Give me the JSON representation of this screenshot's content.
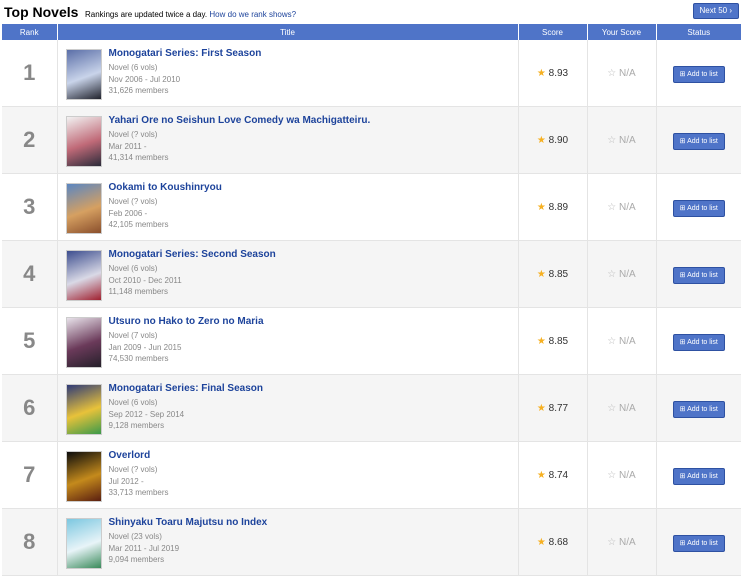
{
  "header": {
    "title": "Top Novels",
    "notice": "Rankings are updated twice a day.",
    "notice_link": "How do we rank shows?",
    "next_label": "Next 50 ›"
  },
  "columns": {
    "rank": "Rank",
    "title": "Title",
    "score": "Score",
    "your_score": "Your Score",
    "status": "Status"
  },
  "rows": [
    {
      "rank": "1",
      "title": "Monogatari Series: First Season",
      "type": "Novel (6 vols)",
      "dates": "Nov 2006 - Jul 2010",
      "members": "31,626 members",
      "score": "8.93",
      "your_score": "N/A",
      "button": "⊞ Add to list",
      "thumb_colors": [
        "#5b6fa8",
        "#c9d4ea",
        "#20222c"
      ]
    },
    {
      "rank": "2",
      "title": "Yahari Ore no Seishun Love Comedy wa Machigatteiru.",
      "type": "Novel (? vols)",
      "dates": "Mar 2011 -",
      "members": "41,314 members",
      "score": "8.90",
      "your_score": "N/A",
      "button": "⊞ Add to list",
      "thumb_colors": [
        "#f2f2f2",
        "#c06a78",
        "#2b2b3a"
      ]
    },
    {
      "rank": "3",
      "title": "Ookami to Koushinryou",
      "type": "Novel (? vols)",
      "dates": "Feb 2006 -",
      "members": "42,105 members",
      "score": "8.89",
      "your_score": "N/A",
      "button": "⊞ Add to list",
      "thumb_colors": [
        "#5a86c2",
        "#d6a061",
        "#8a4f2c"
      ]
    },
    {
      "rank": "4",
      "title": "Monogatari Series: Second Season",
      "type": "Novel (6 vols)",
      "dates": "Oct 2010 - Dec 2011",
      "members": "11,148 members",
      "score": "8.85",
      "your_score": "N/A",
      "button": "⊞ Add to list",
      "thumb_colors": [
        "#3d4e8f",
        "#d9d9e6",
        "#a0202f"
      ]
    },
    {
      "rank": "5",
      "title": "Utsuro no Hako to Zero no Maria",
      "type": "Novel (7 vols)",
      "dates": "Jan 2009 - Jun 2015",
      "members": "74,530 members",
      "score": "8.85",
      "your_score": "N/A",
      "button": "⊞ Add to list",
      "thumb_colors": [
        "#e8e2ea",
        "#6b3a5a",
        "#25202a"
      ]
    },
    {
      "rank": "6",
      "title": "Monogatari Series: Final Season",
      "type": "Novel (6 vols)",
      "dates": "Sep 2012 - Sep 2014",
      "members": "9,128 members",
      "score": "8.77",
      "your_score": "N/A",
      "button": "⊞ Add to list",
      "thumb_colors": [
        "#2e3a78",
        "#e8c23a",
        "#3b9a4a"
      ]
    },
    {
      "rank": "7",
      "title": "Overlord",
      "type": "Novel (? vols)",
      "dates": "Jul 2012 -",
      "members": "33,713 members",
      "score": "8.74",
      "your_score": "N/A",
      "button": "⊞ Add to list",
      "thumb_colors": [
        "#0c0c0c",
        "#c48a1c",
        "#5a1e10"
      ]
    },
    {
      "rank": "8",
      "title": "Shinyaku Toaru Majutsu no Index",
      "type": "Novel (23 vols)",
      "dates": "Mar 2011 - Jul 2019",
      "members": "9,094 members",
      "score": "8.68",
      "your_score": "N/A",
      "button": "⊞ Add to list",
      "thumb_colors": [
        "#7cc7e0",
        "#e8f4f8",
        "#3a8a5a"
      ]
    }
  ],
  "icons": {
    "score_star": "filled-star-icon",
    "your_score_star": "hollow-star-icon",
    "add": "plus-square-icon"
  },
  "colors": {
    "accent": "#4f74c8",
    "link": "#1d439b",
    "star": "#f6b021",
    "row_alt": "#f5f5f5"
  }
}
